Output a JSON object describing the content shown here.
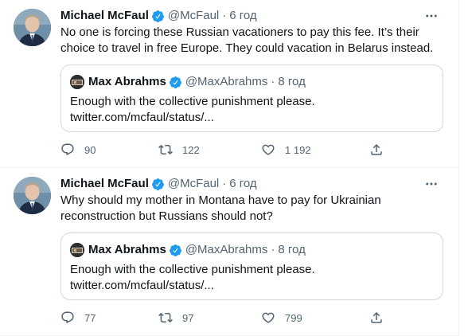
{
  "tweets": [
    {
      "author_name": "Michael McFaul",
      "handle": "@McFaul",
      "separator": "·",
      "time": "6 год",
      "text": "No one is forcing these Russian vacationers to pay this fee. It’s their choice to travel in free Europe. They could vacation in Belarus instead.",
      "quote": {
        "author_name": "Max Abrahms",
        "handle": "@MaxAbrahms",
        "separator": "·",
        "time": "8 год",
        "line1": "Enough with the collective punishment please.",
        "line2": "twitter.com/mcfaul/status/..."
      },
      "replies": "90",
      "retweets": "122",
      "likes": "1 192"
    },
    {
      "author_name": "Michael McFaul",
      "handle": "@McFaul",
      "separator": "·",
      "time": "6 год",
      "text": "Why should my mother in Montana have to pay for Ukrainian reconstruction but Russians should not?",
      "quote": {
        "author_name": "Max Abrahms",
        "handle": "@MaxAbrahms",
        "separator": "·",
        "time": "8 год",
        "line1": "Enough with the collective punishment please.",
        "line2": "twitter.com/mcfaul/status/..."
      },
      "replies": "77",
      "retweets": "97",
      "likes": "799"
    }
  ],
  "colors": {
    "verified": "#1d9bf0",
    "secondary_text": "#536471",
    "border": "#cfd9de"
  },
  "icons": [
    "verified-badge-icon",
    "more-icon",
    "reply-icon",
    "retweet-icon",
    "like-icon",
    "share-icon"
  ]
}
